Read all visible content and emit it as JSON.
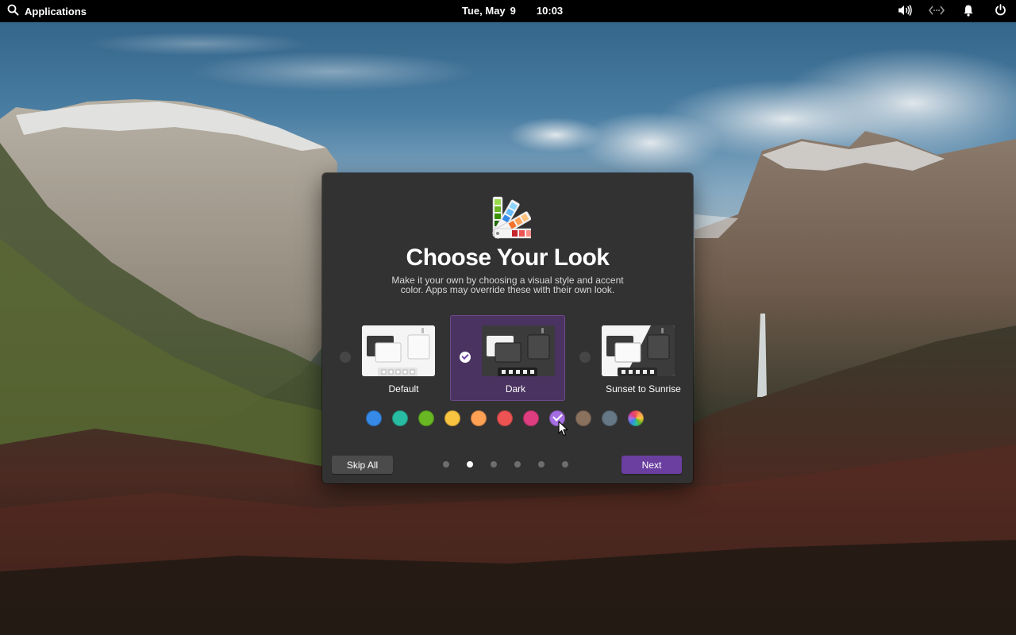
{
  "panel": {
    "applications_label": "Applications",
    "date_day": "Tue, May",
    "date_num": "9",
    "time": "10:03",
    "icons": [
      "search-icon",
      "volume-icon",
      "network-icon",
      "notifications-icon",
      "power-icon"
    ]
  },
  "dialog": {
    "title": "Choose Your Look",
    "description": "Make it your own by choosing a visual style and accent color. Apps may override these with their own look.",
    "styles": [
      {
        "label": "Default",
        "selected": false
      },
      {
        "label": "Dark",
        "selected": true
      },
      {
        "label": "Sunset to Sunrise",
        "selected": false
      }
    ],
    "accents": [
      {
        "name": "blueberry",
        "color": "#3689e6",
        "checked": false
      },
      {
        "name": "mint",
        "color": "#28bca3",
        "checked": false
      },
      {
        "name": "lime",
        "color": "#68b723",
        "checked": false
      },
      {
        "name": "banana",
        "color": "#f9c440",
        "checked": false
      },
      {
        "name": "orange",
        "color": "#ffa154",
        "checked": false
      },
      {
        "name": "strawberry",
        "color": "#ed5353",
        "checked": false
      },
      {
        "name": "bubblegum",
        "color": "#de3e80",
        "checked": false
      },
      {
        "name": "grape",
        "color": "#a56de2",
        "checked": true
      },
      {
        "name": "cocoa",
        "color": "#8a715e",
        "checked": false
      },
      {
        "name": "slate",
        "color": "#667885",
        "checked": false
      },
      {
        "name": "auto",
        "color": "multicolor",
        "checked": false
      }
    ],
    "skip_label": "Skip All",
    "next_label": "Next",
    "pages_total": 6,
    "page_current": 2
  }
}
